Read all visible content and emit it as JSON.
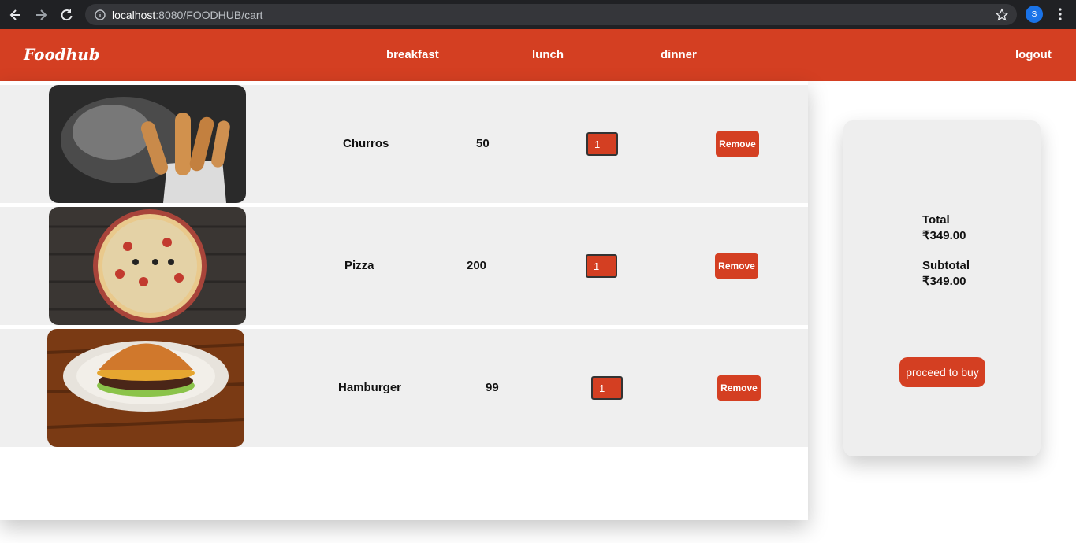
{
  "browser": {
    "url_host": "localhost",
    "url_rest": ":8080/FOODHUB/cart",
    "profile_initial": "S"
  },
  "header": {
    "logo": "Foodhub",
    "nav": [
      "breakfast",
      "lunch",
      "dinner"
    ],
    "logout": "logout"
  },
  "cart": {
    "items": [
      {
        "name": "Churros",
        "price": "50",
        "qty": "1",
        "remove_label": "Remove",
        "image": "churros"
      },
      {
        "name": "Pizza",
        "price": "200",
        "qty": "1",
        "remove_label": "Remove",
        "image": "pizza"
      },
      {
        "name": "Hamburger",
        "price": "99",
        "qty": "1",
        "remove_label": "Remove",
        "image": "hamburger"
      }
    ]
  },
  "summary": {
    "total_label": "Total",
    "total_value": "₹349.00",
    "subtotal_label": "Subtotal",
    "subtotal_value": "₹349.00",
    "buy_label": "proceed to buy"
  },
  "colors": {
    "brand": "#d43f22",
    "row_bg": "#efefef"
  }
}
